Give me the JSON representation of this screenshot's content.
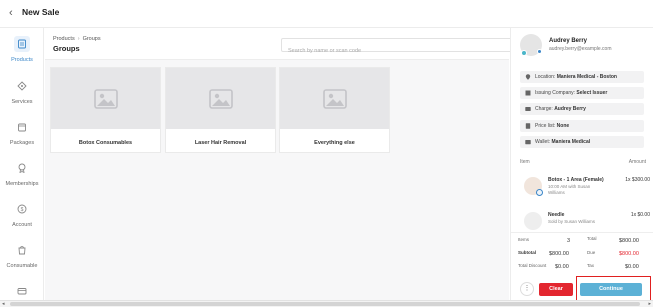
{
  "header": {
    "title": "New Sale"
  },
  "nav": {
    "items": [
      {
        "label": "Products",
        "icon": "products-icon",
        "active": true
      },
      {
        "label": "Services",
        "icon": "services-icon"
      },
      {
        "label": "Packages",
        "icon": "packages-icon"
      },
      {
        "label": "Memberships",
        "icon": "memberships-icon"
      },
      {
        "label": "Account",
        "icon": "account-icon"
      },
      {
        "label": "Consumable",
        "icon": "consumable-icon"
      },
      {
        "label": "",
        "icon": "gift-card-icon"
      }
    ]
  },
  "main": {
    "breadcrumb": {
      "root": "Products",
      "current": "Groups"
    },
    "title": "Groups",
    "search": {
      "placeholder": "Search by name or scan code",
      "value": ""
    },
    "groups": [
      {
        "name": "Botox Consumables"
      },
      {
        "name": "Laser Hair Removal"
      },
      {
        "name": "Everything else"
      }
    ]
  },
  "customer": {
    "name": "Audrey Berry",
    "email": "audrey.berry@example.com",
    "location_label": "Location:",
    "location": "Maniera Medical - Boston",
    "issuing_label": "Issuing Company:",
    "issuing": "Select Issuer",
    "charge_label": "Charge:",
    "charge": "Audrey Berry",
    "pricelist_label": "Price list:",
    "pricelist": "None",
    "wallet_label": "Wallet:",
    "wallet": "Maniera Medical"
  },
  "cart": {
    "col_item": "Item",
    "col_amount": "Amount",
    "items": [
      {
        "name": "Botox - 1 Area (Female)",
        "sub": "10:00 AM with Susan Williams",
        "qty": "1x $300.00"
      },
      {
        "name": "Needle",
        "sub": "Sold by Susan Williams",
        "qty": "1x $0.00"
      }
    ],
    "items_label": "Items",
    "items_count": "3",
    "subtotal_label": "Subtotal",
    "subtotal": "$800.00",
    "discount_label": "Total Discount",
    "discount": "$0.00",
    "total_label": "Total",
    "total": "$800.00",
    "due_label": "Due",
    "due": "$800.00",
    "tax_label": "Tax",
    "tax": "$0.00"
  },
  "actions": {
    "more": "⋮",
    "clear": "Clear",
    "continue": "Continue"
  },
  "colors": {
    "accent": "#3a86c8",
    "clear": "#e3262f",
    "continue": "#5cb1d6",
    "due": "#e3262f"
  }
}
